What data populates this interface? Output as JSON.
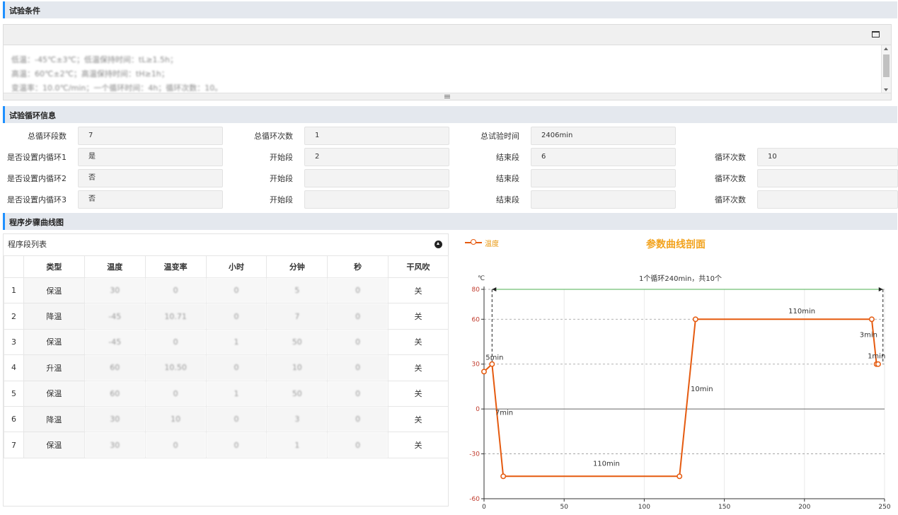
{
  "sections": {
    "conditions": "试验条件",
    "cycle_info": "试验循环信息",
    "curve": "程序步骤曲线图"
  },
  "conditions": {
    "lines": [
      "低温：-45℃±3℃；低温保持时间：tL≥1.5h；",
      "高温：60℃±2℃；高温保持时间：tH≥1h；",
      "变温率：10.0℃/min；一个循环时间：4h；循环次数：10。"
    ]
  },
  "cycle": {
    "total_segments_label": "总循环段数",
    "total_segments": "7",
    "total_cycles_label": "总循环次数",
    "total_cycles": "1",
    "total_time_label": "总试验时间",
    "total_time": "2406min",
    "inner": [
      {
        "label": "是否设置内循环1",
        "value": "是",
        "start_label": "开始段",
        "start": "2",
        "end_label": "结束段",
        "end": "6",
        "count_label": "循环次数",
        "count": "10"
      },
      {
        "label": "是否设置内循环2",
        "value": "否",
        "start_label": "开始段",
        "start": "",
        "end_label": "结束段",
        "end": "",
        "count_label": "循环次数",
        "count": ""
      },
      {
        "label": "是否设置内循环3",
        "value": "否",
        "start_label": "开始段",
        "start": "",
        "end_label": "结束段",
        "end": "",
        "count_label": "循环次数",
        "count": ""
      }
    ]
  },
  "steps_table": {
    "title": "程序段列表",
    "headers": [
      "",
      "类型",
      "温度",
      "温变率",
      "小时",
      "分钟",
      "秒",
      "干风吹"
    ],
    "rows": [
      [
        "1",
        "保温",
        "30",
        "0",
        "0",
        "5",
        "0",
        "关"
      ],
      [
        "2",
        "降温",
        "-45",
        "10.71",
        "0",
        "7",
        "0",
        "关"
      ],
      [
        "3",
        "保温",
        "-45",
        "0",
        "1",
        "50",
        "0",
        "关"
      ],
      [
        "4",
        "升温",
        "60",
        "10.50",
        "0",
        "10",
        "0",
        "关"
      ],
      [
        "5",
        "保温",
        "60",
        "0",
        "1",
        "50",
        "0",
        "关"
      ],
      [
        "6",
        "降温",
        "30",
        "10",
        "0",
        "3",
        "0",
        "关"
      ],
      [
        "7",
        "保温",
        "30",
        "0",
        "0",
        "1",
        "0",
        "关"
      ]
    ]
  },
  "chart_data": {
    "type": "line",
    "title": "参数曲线剖面",
    "ylabel": "℃",
    "xlim": [
      0,
      250
    ],
    "ylim": [
      -60,
      80
    ],
    "x_ticks": [
      0,
      50,
      100,
      150,
      200,
      250
    ],
    "y_ticks": [
      -60,
      -30,
      0,
      30,
      60,
      80
    ],
    "series": [
      {
        "name": "温度",
        "color": "#e55a0f",
        "x": [
          0,
          5,
          12,
          122,
          132,
          242,
          245,
          246
        ],
        "y": [
          25,
          30,
          -45,
          -45,
          60,
          60,
          30,
          30
        ]
      }
    ],
    "segment_labels": [
      {
        "text": "5min",
        "x": 1,
        "y": 33
      },
      {
        "text": "7min",
        "x": 7,
        "y": -4
      },
      {
        "text": "110min",
        "x": 68,
        "y": -38
      },
      {
        "text": "10min",
        "x": 129,
        "y": 12
      },
      {
        "text": "110min",
        "x": 190,
        "y": 64
      },
      {
        "text": "3min",
        "x": 240,
        "y": 48
      },
      {
        "text": "1min",
        "x": 245,
        "y": 34
      }
    ],
    "cycle_annotation": "1个循环240min，共10个",
    "cycle_start_x": 5,
    "cycle_end_x": 249,
    "grid": true,
    "legend": "top-left"
  }
}
